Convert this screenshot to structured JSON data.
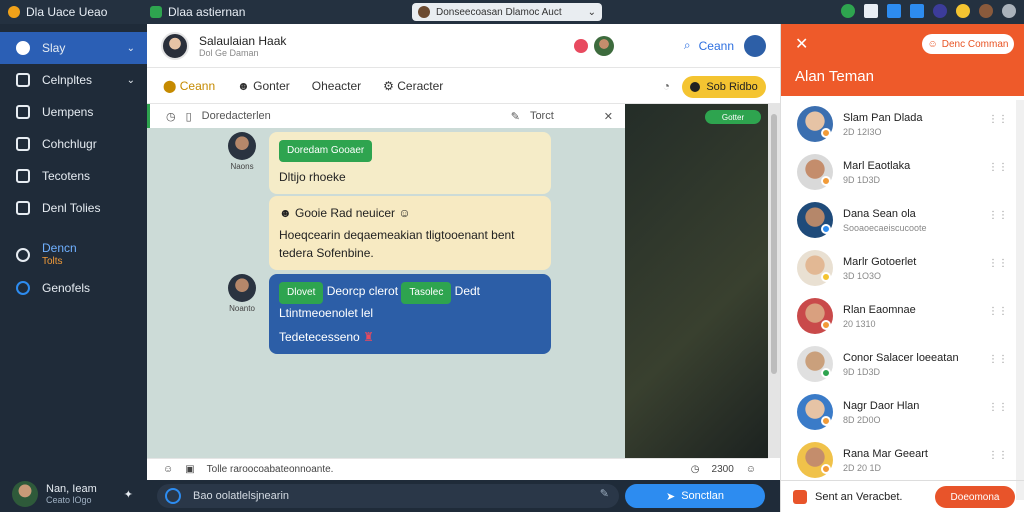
{
  "topbar": {
    "app_name": "Dla Uace Ueao",
    "tab_name": "Dlaa astiernan",
    "address": "Donseecoasan Dlamoc Auct"
  },
  "sidebar": {
    "items": [
      {
        "label": "Slay",
        "icon": "circle-icon",
        "active": true
      },
      {
        "label": "Celnpltes",
        "icon": "user-icon"
      },
      {
        "label": "Uempens",
        "icon": "home-icon"
      },
      {
        "label": "Cohchlugr",
        "icon": "grid-icon"
      },
      {
        "label": "Tecotens",
        "icon": "list-icon"
      },
      {
        "label": "Denl Tolies",
        "icon": "folder-icon"
      },
      {
        "label": "Dencn",
        "sub": "Tolts",
        "icon": "gauge-icon"
      },
      {
        "label": "Genofels",
        "icon": "globe-icon"
      }
    ],
    "user": {
      "name": "Nan, Ieam",
      "status": "Ceato lOgo"
    }
  },
  "chat": {
    "title": "Salaulaian Haak",
    "subtitle": "Dol Ge Daman",
    "filters": [
      "Ceann",
      "Gonter",
      "Oheacter",
      "Ceracter"
    ],
    "action_pill": "Sob Ridbo",
    "thread_title": "Doredacterlen",
    "thread_right": "Torct",
    "video_tag": "Gotter",
    "messages": [
      {
        "author": "Naons",
        "tag": "Doredam Gooaer",
        "text": "Dltijo rhoeke",
        "style": "yellow"
      },
      {
        "author": "",
        "tag": "",
        "text": "Gooie Rad neuicer",
        "text2": "Hoeqcearin deqaemeakian tligtooenant bent tedera Sofenbine.",
        "style": "yellow"
      },
      {
        "author": "Noanto",
        "tag": "Dlovet",
        "text": "Deorcp clerot",
        "tag2": "Tasolec",
        "text3": "Dedt Ltintmeoenolet lel",
        "text2": "Tedetecesseno",
        "style": "blue"
      }
    ],
    "composer_hint": "Tolle raroocoabateonnoante.",
    "composer_count": "2300",
    "input_placeholder": "Bao oolatlelsjnearin",
    "send_label": "Sonctlan"
  },
  "panel": {
    "title": "Alan Teman",
    "header_button": "Denc Comman",
    "contacts": [
      {
        "name": "Slam Pan Dlada",
        "status": "2D 12I3O",
        "badge": "#f29b38"
      },
      {
        "name": "Marl Eaotlaka",
        "status": "9D 1D3D",
        "badge": "#f29b38"
      },
      {
        "name": "Dana Sean ola",
        "status": "Sooaoecaeiscucoote",
        "badge": "#2d8cf0"
      },
      {
        "name": "Marlr Gotoerlet",
        "status": "3D 1O3O",
        "badge": "#f4c431"
      },
      {
        "name": "Rlan Eaomnae",
        "status": "20 1310",
        "badge": "#f29b38"
      },
      {
        "name": "Conor Salacer loeeatan",
        "status": "9D 1D3D",
        "badge": "#2ea44f"
      },
      {
        "name": "Nagr Daor Hlan",
        "status": "8D 2D0O",
        "badge": "#f29b38"
      },
      {
        "name": "Rana Mar Geeart",
        "status": "2D 20 1D",
        "badge": "#f29b38"
      }
    ],
    "foot_text": "Sent an Veracbet.",
    "foot_button": "Doeomona"
  }
}
